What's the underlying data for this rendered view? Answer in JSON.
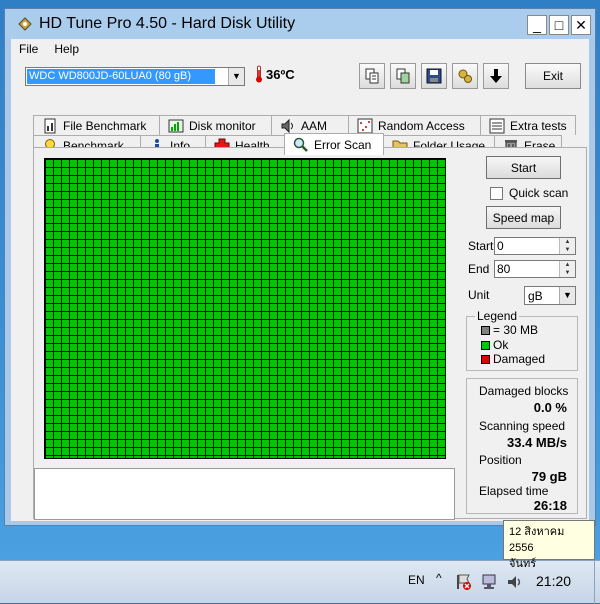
{
  "window": {
    "title": "HD Tune Pro 4.50 - Hard Disk Utility",
    "controls": {
      "minimize": "_",
      "maximize": "□",
      "close": "✕"
    }
  },
  "menu": [
    "File",
    "Help"
  ],
  "toolbar": {
    "drive": "WDC WD800JD-60LUA0 (80 gB)",
    "temperature": "36ºC",
    "exit_label": "Exit",
    "icons": [
      "copy-text-icon",
      "copy-screenshot-icon",
      "save-icon",
      "options-icon",
      "download-icon"
    ]
  },
  "tabs_top": [
    {
      "label": "File Benchmark",
      "icon": "file-benchmark-icon"
    },
    {
      "label": "Disk monitor",
      "icon": "disk-monitor-icon"
    },
    {
      "label": "AAM",
      "icon": "speaker-icon"
    },
    {
      "label": "Random Access",
      "icon": "random-access-icon"
    },
    {
      "label": "Extra tests",
      "icon": "extra-tests-icon"
    }
  ],
  "tabs_bottom": [
    {
      "label": "Benchmark",
      "icon": "lightbulb-icon"
    },
    {
      "label": "Info",
      "icon": "info-icon"
    },
    {
      "label": "Health",
      "icon": "health-cross-icon"
    },
    {
      "label": "Error Scan",
      "icon": "magnifier-icon",
      "active": true
    },
    {
      "label": "Folder Usage",
      "icon": "folder-icon"
    },
    {
      "label": "Erase",
      "icon": "trash-icon"
    }
  ],
  "scan": {
    "start_button": "Start",
    "quick_scan_label": "Quick scan",
    "quick_scan_checked": false,
    "speed_map_button": "Speed map",
    "start_label": "Start",
    "start_value": "0",
    "end_label": "End",
    "end_value": "80",
    "unit_label": "Unit",
    "unit_value": "gB",
    "block_color": "#00c800"
  },
  "legend": {
    "title": "Legend",
    "items": [
      {
        "label": "= 30 MB",
        "color": "#808080"
      },
      {
        "label": "Ok",
        "color": "#00c800"
      },
      {
        "label": "Damaged",
        "color": "#e00000"
      }
    ]
  },
  "stats": {
    "damaged_blocks_label": "Damaged blocks",
    "damaged_blocks_value": "0.0 %",
    "scanning_speed_label": "Scanning speed",
    "scanning_speed_value": "33.4 MB/s",
    "position_label": "Position",
    "position_value": "79 gB",
    "elapsed_label": "Elapsed time",
    "elapsed_value": "26:18"
  },
  "taskbar": {
    "language": "EN",
    "show_hidden": "^",
    "clock": "21:20",
    "tooltip_line1": "12 สิงหาคม 2556",
    "tooltip_line2": "จันทร์"
  }
}
